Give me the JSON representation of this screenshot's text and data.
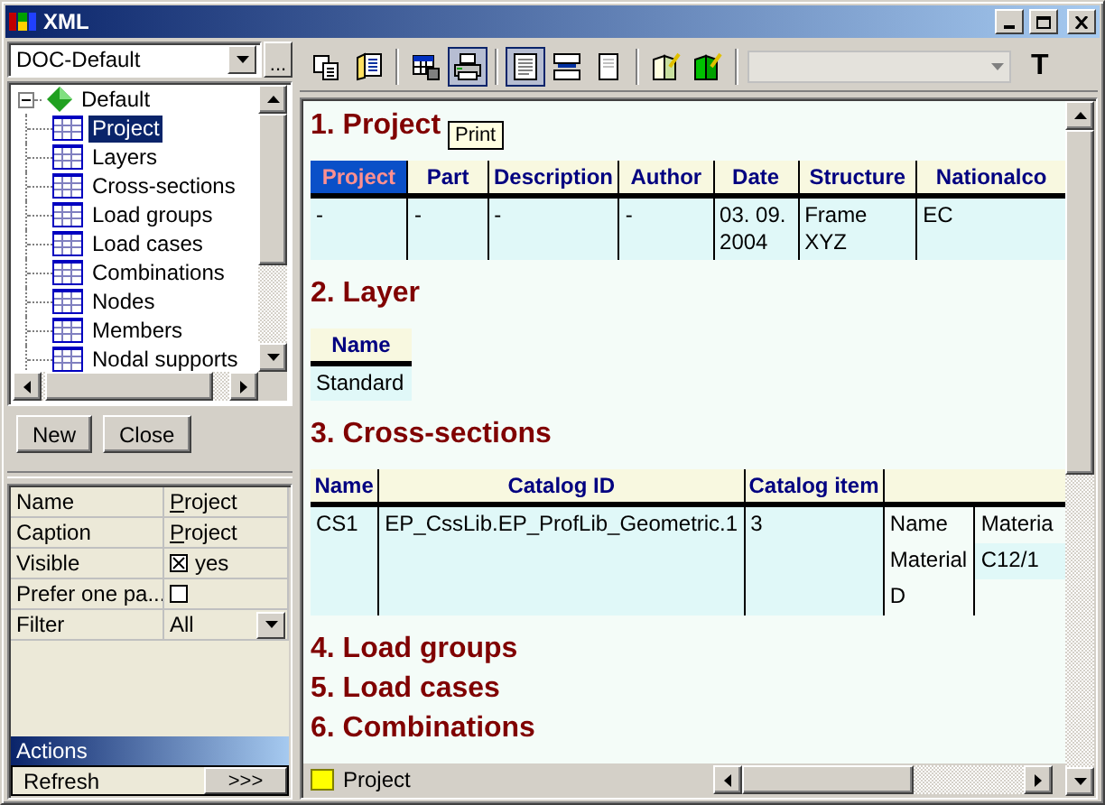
{
  "window": {
    "title": "XML"
  },
  "document_selector": {
    "value": "DOC-Default",
    "more_button": "..."
  },
  "tree": {
    "label": "Default",
    "expanded": true,
    "children": [
      {
        "label": "Project",
        "selected": true
      },
      {
        "label": "Layers",
        "selected": false
      },
      {
        "label": "Cross-sections",
        "selected": false
      },
      {
        "label": "Load groups",
        "selected": false
      },
      {
        "label": "Load cases",
        "selected": false
      },
      {
        "label": "Combinations",
        "selected": false
      },
      {
        "label": "Nodes",
        "selected": false
      },
      {
        "label": "Members",
        "selected": false
      },
      {
        "label": "Nodal supports",
        "selected": false
      }
    ]
  },
  "tree_buttons": [
    "New",
    "Close"
  ],
  "properties": [
    {
      "name": "Name",
      "kind": "text",
      "value": "Project"
    },
    {
      "name": "Caption",
      "kind": "text",
      "value": "Project"
    },
    {
      "name": "Visible",
      "kind": "checkbox",
      "checked": true,
      "value": "yes"
    },
    {
      "name": "Prefer one pa...",
      "kind": "checkbox",
      "checked": false
    },
    {
      "name": "Filter",
      "kind": "dropdown",
      "value": "All"
    }
  ],
  "actions": {
    "title": "Actions",
    "items": [
      {
        "label": "Refresh",
        "button": ">>>"
      }
    ]
  },
  "toolbar": {
    "buttons": [
      {
        "kind": "copy",
        "pressed": false
      },
      {
        "kind": "book",
        "pressed": false
      },
      {
        "kind": "table",
        "pressed": false
      },
      {
        "kind": "print",
        "pressed": true
      },
      {
        "kind": "page-lines",
        "pressed": true
      },
      {
        "kind": "split",
        "pressed": false
      },
      {
        "kind": "page",
        "pressed": false
      },
      {
        "kind": "notebook",
        "pressed": false
      },
      {
        "kind": "notebook-green",
        "pressed": false
      }
    ],
    "text_button": "T"
  },
  "tooltip": "Print",
  "sections": [
    {
      "title": "1. Project",
      "columns": [
        {
          "label": "Project",
          "selected": true
        },
        {
          "label": "Part",
          "selected": false
        },
        {
          "label": "Description",
          "selected": false
        },
        {
          "label": "Author",
          "selected": false
        },
        {
          "label": "Date",
          "selected": false
        },
        {
          "label": "Structure",
          "selected": false
        },
        {
          "label": "Nationalco",
          "selected": false
        }
      ],
      "rows": [
        {
          "cells": [
            "-",
            "-",
            "-",
            "-",
            "03. 09. 2004",
            "Frame XYZ",
            "EC"
          ]
        }
      ]
    },
    {
      "title": "2. Layer",
      "columns": [
        {
          "label": "Name",
          "selected": false
        }
      ],
      "rows": [
        {
          "cells": [
            "Standard"
          ]
        }
      ]
    },
    {
      "title": "3. Cross-sections",
      "columns": [
        {
          "label": "Name",
          "selected": false
        },
        {
          "label": "Catalog ID",
          "selected": false
        },
        {
          "label": "Catalog item",
          "selected": false
        }
      ],
      "rows": [
        {
          "cells": [
            "CS1",
            "EP_CssLib.EP_ProfLib_Geometric.1",
            "3"
          ],
          "details": [
            [
              "Name",
              "Materia"
            ],
            [
              "Material",
              "C12/1"
            ],
            [
              "D"
            ]
          ]
        }
      ]
    },
    {
      "title": "4. Load groups"
    },
    {
      "title": "5. Load cases"
    },
    {
      "title": "6. Combinations"
    }
  ],
  "status_bar": {
    "label": "Project"
  }
}
